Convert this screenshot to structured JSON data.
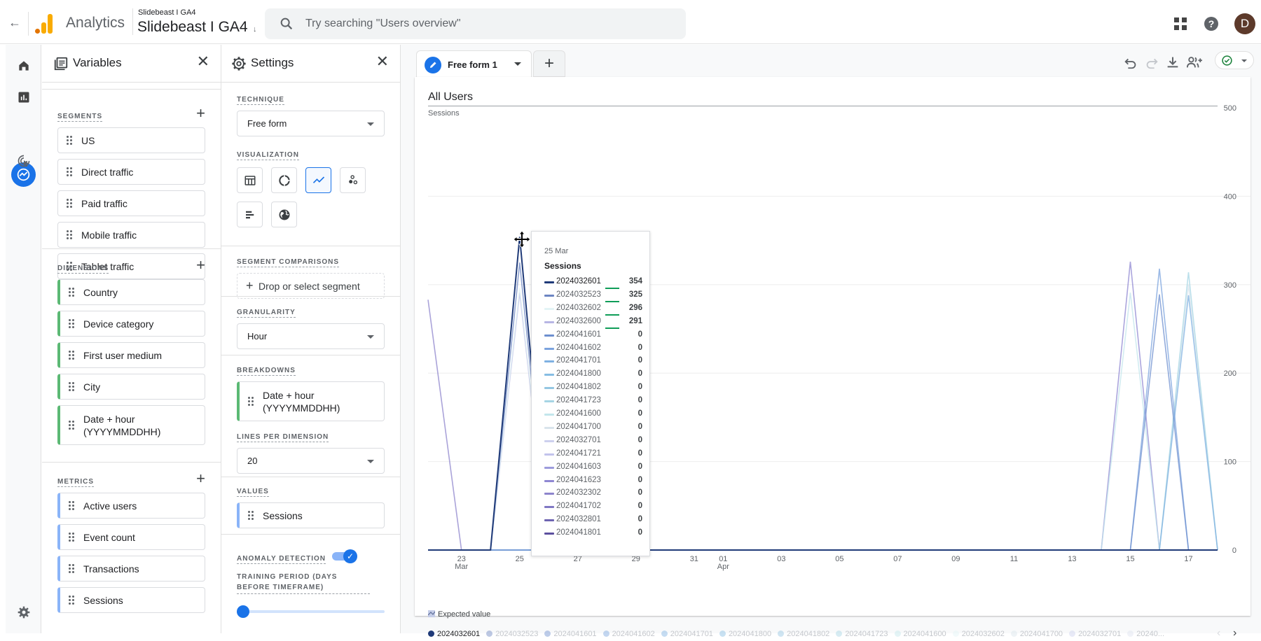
{
  "header": {
    "app_name": "Analytics",
    "account_small": "Slidebeast I GA4",
    "account_big": "Slidebeast I GA4",
    "search_placeholder": "Try searching \"Users overview\"",
    "avatar_letter": "D"
  },
  "variables_panel": {
    "title": "Variables",
    "segments": {
      "label": "SEGMENTS",
      "items": [
        "US",
        "Direct traffic",
        "Paid traffic",
        "Mobile traffic",
        "Tablet traffic"
      ]
    },
    "dimensions": {
      "label": "DIMENSIONS",
      "items": [
        "Country",
        "Device category",
        "First user medium",
        "City",
        "Date + hour (YYYYMMDDHH)"
      ]
    },
    "metrics": {
      "label": "METRICS",
      "items": [
        "Active users",
        "Event count",
        "Transactions",
        "Sessions"
      ]
    }
  },
  "settings_panel": {
    "title": "Settings",
    "technique": {
      "label": "TECHNIQUE",
      "value": "Free form"
    },
    "visualization": {
      "label": "VISUALIZATION",
      "options": [
        "table",
        "donut",
        "line",
        "scatter",
        "bar",
        "geo"
      ],
      "selected": "line"
    },
    "segment_comparisons": {
      "label": "SEGMENT COMPARISONS",
      "placeholder": "Drop or select segment"
    },
    "granularity": {
      "label": "GRANULARITY",
      "value": "Hour"
    },
    "breakdowns": {
      "label": "BREAKDOWNS",
      "items": [
        "Date + hour (YYYYMMDDHH)"
      ]
    },
    "lines_per_dimension": {
      "label": "LINES PER DIMENSION",
      "value": "20"
    },
    "values": {
      "label": "VALUES",
      "items": [
        "Sessions"
      ]
    },
    "anomaly_detection": {
      "label": "ANOMALY DETECTION",
      "enabled": true
    },
    "training_period": {
      "label": "TRAINING PERIOD (DAYS BEFORE TIMEFRAME)",
      "value_fraction": 0
    }
  },
  "canvas": {
    "tab_label": "Free form 1",
    "add_tab_label": "+",
    "toolbar": [
      "undo-icon",
      "redo-icon",
      "download-icon",
      "share-icon",
      "status-check-icon"
    ]
  },
  "chart_data": {
    "type": "line",
    "title": "All Users",
    "subtitle": "Sessions",
    "ylabel": "Sessions",
    "ylim": [
      0,
      500
    ],
    "yticks": [
      0,
      100,
      200,
      300,
      400,
      500
    ],
    "xlim": [
      21.85,
      49.0
    ],
    "xticks": [
      {
        "x": 23,
        "label": "23",
        "sub": "Mar"
      },
      {
        "x": 25,
        "label": "25",
        "sub": ""
      },
      {
        "x": 27,
        "label": "27",
        "sub": ""
      },
      {
        "x": 29,
        "label": "29",
        "sub": ""
      },
      {
        "x": 31,
        "label": "31",
        "sub": ""
      },
      {
        "x": 32,
        "label": "01",
        "sub": "Apr"
      },
      {
        "x": 34,
        "label": "03",
        "sub": ""
      },
      {
        "x": 36,
        "label": "05",
        "sub": ""
      },
      {
        "x": 38,
        "label": "07",
        "sub": ""
      },
      {
        "x": 40,
        "label": "09",
        "sub": ""
      },
      {
        "x": 42,
        "label": "11",
        "sub": ""
      },
      {
        "x": 44,
        "label": "13",
        "sub": ""
      },
      {
        "x": 46,
        "label": "15",
        "sub": ""
      },
      {
        "x": 48,
        "label": "17",
        "sub": ""
      }
    ],
    "grid": true,
    "series": [
      {
        "name": "2024032601",
        "color": "#1f3a78",
        "points": [
          [
            21.85,
            0
          ],
          [
            24,
            0
          ],
          [
            25,
            354
          ],
          [
            26,
            0
          ],
          [
            49,
            0
          ]
        ]
      },
      {
        "name": "2024032523",
        "color": "#6c85c2",
        "points": [
          [
            21.85,
            0
          ],
          [
            24,
            0
          ],
          [
            25,
            325
          ],
          [
            26,
            0
          ],
          [
            49,
            0
          ]
        ]
      },
      {
        "name": "2024032602",
        "color": "#e3f4f6",
        "points": [
          [
            21.85,
            0
          ],
          [
            24,
            0
          ],
          [
            25,
            296
          ],
          [
            26,
            0
          ],
          [
            49,
            0
          ]
        ]
      },
      {
        "name": "2024032600",
        "color": "#b7b5e4",
        "points": [
          [
            21.85,
            0
          ],
          [
            24,
            0
          ],
          [
            25,
            291
          ],
          [
            26,
            0
          ],
          [
            49,
            0
          ]
        ]
      },
      {
        "name": "2024041601",
        "color": "#6d8fcf",
        "points": [
          [
            21.85,
            0
          ],
          [
            46,
            0
          ],
          [
            47,
            289
          ],
          [
            48,
            0
          ],
          [
            49,
            0
          ]
        ]
      },
      {
        "name": "2024041602",
        "color": "#7ba3de",
        "points": [
          [
            21.85,
            0
          ],
          [
            46,
            0
          ],
          [
            47,
            318
          ],
          [
            48,
            0
          ],
          [
            49,
            0
          ]
        ]
      },
      {
        "name": "2024041701",
        "color": "#7fb1e2",
        "points": [
          [
            21.85,
            0
          ],
          [
            47,
            0
          ],
          [
            48,
            288
          ],
          [
            49,
            0
          ]
        ]
      },
      {
        "name": "2024041800",
        "color": "#86bde3",
        "points": [
          [
            21.85,
            0
          ],
          [
            48,
            0
          ],
          [
            49,
            0
          ]
        ]
      },
      {
        "name": "2024041802",
        "color": "#94c6e2",
        "points": [
          [
            21.85,
            0
          ],
          [
            49,
            0
          ]
        ]
      },
      {
        "name": "2024041723",
        "color": "#a6d5e4",
        "points": [
          [
            21.85,
            0
          ],
          [
            47,
            0
          ],
          [
            48,
            314
          ],
          [
            49,
            0
          ]
        ]
      },
      {
        "name": "2024041600",
        "color": "#c3e6ec",
        "points": [
          [
            21.85,
            0
          ],
          [
            45,
            0
          ],
          [
            46,
            291
          ],
          [
            47,
            0
          ],
          [
            49,
            0
          ]
        ]
      },
      {
        "name": "2024041700",
        "color": "#d9e4ec",
        "points": [
          [
            21.85,
            0
          ],
          [
            47,
            0
          ],
          [
            48,
            300
          ],
          [
            49,
            0
          ]
        ]
      },
      {
        "name": "2024032701",
        "color": "#cdd0ee",
        "points": [
          [
            21.85,
            0
          ],
          [
            49,
            0
          ]
        ]
      },
      {
        "name": "2024041721",
        "color": "#c2c3ec",
        "points": [
          [
            21.85,
            0
          ],
          [
            49,
            0
          ]
        ]
      },
      {
        "name": "2024041603",
        "color": "#9c9bdc",
        "points": [
          [
            21.85,
            0
          ],
          [
            49,
            0
          ]
        ]
      },
      {
        "name": "2024041623",
        "color": "#8f87d2",
        "points": [
          [
            21.85,
            0
          ],
          [
            45,
            0
          ],
          [
            46,
            326
          ],
          [
            47,
            0
          ],
          [
            49,
            0
          ]
        ]
      },
      {
        "name": "2024032302",
        "color": "#8d84cc",
        "points": [
          [
            21.85,
            283
          ],
          [
            23,
            0
          ],
          [
            49,
            0
          ]
        ]
      },
      {
        "name": "2024041702",
        "color": "#8078c4",
        "points": [
          [
            21.85,
            0
          ],
          [
            49,
            0
          ]
        ]
      },
      {
        "name": "2024032801",
        "color": "#6e64b1",
        "points": [
          [
            21.85,
            0
          ],
          [
            49,
            0
          ]
        ]
      },
      {
        "name": "2024041801",
        "color": "#5c4f9e",
        "points": [
          [
            21.85,
            0
          ],
          [
            49,
            0
          ]
        ]
      }
    ],
    "tooltip": {
      "date": "25 Mar",
      "metric": "Sessions",
      "rows": [
        {
          "name": "2024032601",
          "value": "354"
        },
        {
          "name": "2024032523",
          "value": "325"
        },
        {
          "name": "2024032602",
          "value": "296"
        },
        {
          "name": "2024032600",
          "value": "291"
        },
        {
          "name": "2024041601",
          "value": "0"
        },
        {
          "name": "2024041602",
          "value": "0"
        },
        {
          "name": "2024041701",
          "value": "0"
        },
        {
          "name": "2024041800",
          "value": "0"
        },
        {
          "name": "2024041802",
          "value": "0"
        },
        {
          "name": "2024041723",
          "value": "0"
        },
        {
          "name": "2024041600",
          "value": "0"
        },
        {
          "name": "2024041700",
          "value": "0"
        },
        {
          "name": "2024032701",
          "value": "0"
        },
        {
          "name": "2024041721",
          "value": "0"
        },
        {
          "name": "2024041603",
          "value": "0"
        },
        {
          "name": "2024041623",
          "value": "0"
        },
        {
          "name": "2024032302",
          "value": "0"
        },
        {
          "name": "2024041702",
          "value": "0"
        },
        {
          "name": "2024032801",
          "value": "0"
        },
        {
          "name": "2024041801",
          "value": "0"
        }
      ]
    },
    "expected_value_label": "Expected value",
    "legend": {
      "placement": "bottom",
      "active": "2024032601",
      "items": [
        "2024032601",
        "2024032523",
        "2024041601",
        "2024041602",
        "2024041701",
        "2024041800",
        "2024041802",
        "2024041723",
        "2024041600",
        "2024032602",
        "2024041700",
        "2024032701",
        "20240..."
      ]
    }
  }
}
